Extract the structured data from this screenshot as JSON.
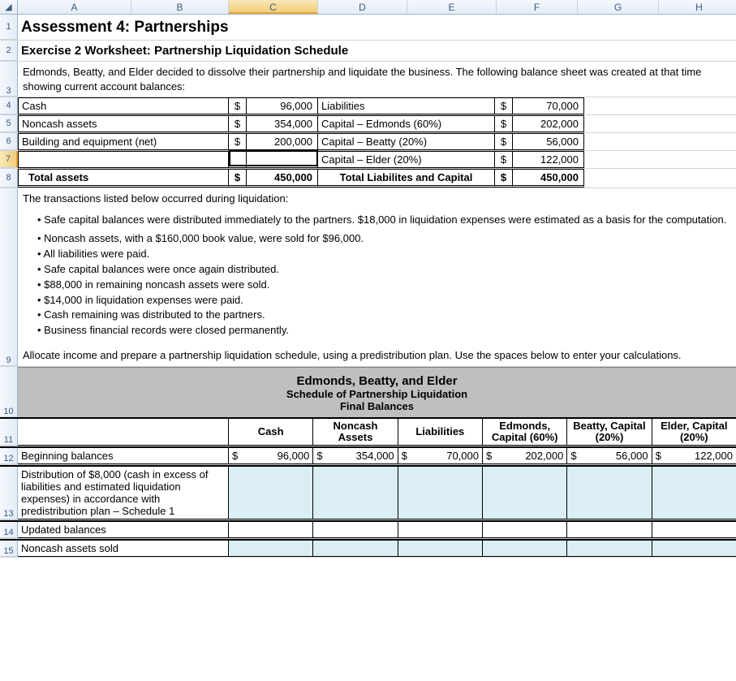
{
  "columns": [
    "A",
    "B",
    "C",
    "D",
    "E",
    "F",
    "G",
    "H"
  ],
  "selected_column": "C",
  "row_labels": [
    "1",
    "2",
    "3",
    "4",
    "5",
    "6",
    "7",
    "8",
    "9",
    "10",
    "11",
    "12",
    "13",
    "14",
    "15"
  ],
  "selected_row": "7",
  "title": "Assessment 4:  Partnerships",
  "subtitle": "Exercise 2 Worksheet: Partnership Liquidation Schedule",
  "intro": "Edmonds, Beatty, and Elder decided to dissolve their partnership and liquidate the business. The following balance sheet was created at that time showing current account balances:",
  "balance_sheet": {
    "rows": [
      {
        "leftLabel": "Cash",
        "leftVal": "96,000",
        "rightLabel": "Liabilities",
        "rightVal": "70,000"
      },
      {
        "leftLabel": "Noncash assets",
        "leftVal": "354,000",
        "rightLabel": "Capital – Edmonds (60%)",
        "rightVal": "202,000"
      },
      {
        "leftLabel": "Building and equipment (net)",
        "leftVal": "200,000",
        "rightLabel": "Capital – Beatty (20%)",
        "rightVal": "56,000"
      },
      {
        "leftLabel": "",
        "leftVal": "",
        "rightLabel": "Capital – Elder (20%)",
        "rightVal": "122,000"
      }
    ],
    "totals": {
      "leftLabel": "Total assets",
      "leftVal": "450,000",
      "rightLabel": "Total Liabilites and Capital",
      "rightVal": "450,000"
    }
  },
  "transactions_intro": "The transactions listed below occurred during liquidation:",
  "bullets_first": "Safe capital balances were distributed immediately to the partners. $18,000 in liquidation expenses were estimated as a basis for the computation.",
  "bullets": [
    "Noncash assets, with a $160,000 book value, were sold for $96,000.",
    "All liabilities were paid.",
    "Safe capital balances were once again distributed.",
    "$88,000 in remaining noncash assets were sold.",
    "$14,000 in liquidation expenses were paid.",
    "Cash remaining was distributed to the partners.",
    "Business financial records were closed permanently."
  ],
  "allocate_text": "Allocate income and prepare a partnership liquidation schedule, using a predistribution plan. Use the spaces below to enter your calculations.",
  "schedule": {
    "header1": "Edmonds, Beatty, and Elder",
    "header2": "Schedule of Partnership Liquidation",
    "header3": "Final Balances",
    "columns": [
      "Cash",
      "Noncash Assets",
      "Liabilities",
      "Edmonds, Capital (60%)",
      "Beatty, Capital (20%)",
      "Elder, Capital (20%)"
    ],
    "rows": [
      {
        "label": "Beginning balances",
        "vals": [
          "96,000",
          "354,000",
          "70,000",
          "202,000",
          "56,000",
          "122,000"
        ],
        "blue": false
      },
      {
        "label": "Distribution of $8,000 (cash in excess of liabilities and estimated liquidation expenses) in accordance with predistribution plan – Schedule 1",
        "vals": [
          "",
          "",
          "",
          "",
          "",
          ""
        ],
        "blue": true
      },
      {
        "label": "Updated balances",
        "vals": [
          "",
          "",
          "",
          "",
          "",
          ""
        ],
        "blue": false
      },
      {
        "label": "Noncash assets sold",
        "vals": [
          "",
          "",
          "",
          "",
          "",
          ""
        ],
        "blue": true
      }
    ]
  },
  "chart_data": {
    "type": "table",
    "title": "Balance Sheet at Liquidation",
    "assets": [
      {
        "item": "Cash",
        "value": 96000
      },
      {
        "item": "Noncash assets",
        "value": 354000
      },
      {
        "item": "Building and equipment (net)",
        "value": 200000
      }
    ],
    "total_assets": 450000,
    "liabilities_and_capital": [
      {
        "item": "Liabilities",
        "value": 70000
      },
      {
        "item": "Capital – Edmonds (60%)",
        "value": 202000
      },
      {
        "item": "Capital – Beatty (20%)",
        "value": 56000
      },
      {
        "item": "Capital – Elder (20%)",
        "value": 122000
      }
    ],
    "total_liabilities_and_capital": 450000,
    "liquidation_schedule_beginning": {
      "Cash": 96000,
      "Noncash Assets": 354000,
      "Liabilities": 70000,
      "Edmonds Capital 60%": 202000,
      "Beatty Capital 20%": 56000,
      "Elder Capital 20%": 122000
    }
  }
}
